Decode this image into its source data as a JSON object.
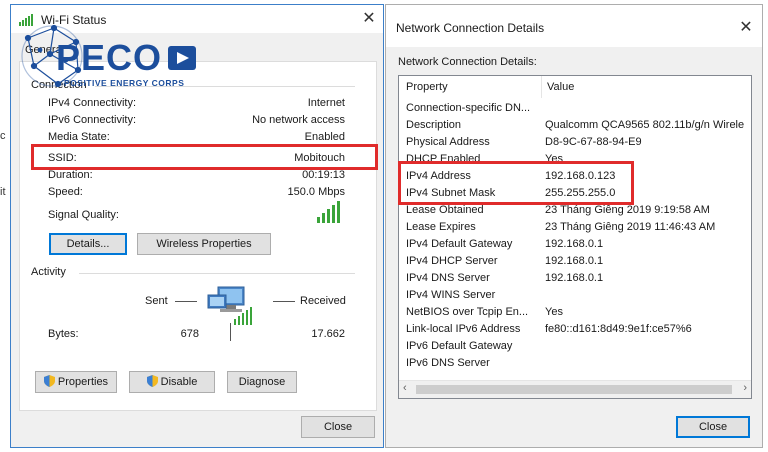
{
  "wifi": {
    "title": "Wi-Fi Status",
    "tab_general": "General",
    "connection_heading": "Connection",
    "rows": [
      {
        "label": "IPv4 Connectivity:",
        "value": "Internet"
      },
      {
        "label": "IPv6 Connectivity:",
        "value": "No network access"
      },
      {
        "label": "Media State:",
        "value": "Enabled"
      },
      {
        "label": "SSID:",
        "value": "Mobitouch"
      },
      {
        "label": "Duration:",
        "value": "00:19:13"
      },
      {
        "label": "Speed:",
        "value": "150.0 Mbps"
      }
    ],
    "signal_label": "Signal Quality:",
    "signal_level": 5,
    "details_button": "Details...",
    "wireless_props_button": "Wireless Properties",
    "activity_heading": "Activity",
    "sent_label": "Sent",
    "received_label": "Received",
    "bytes_label": "Bytes:",
    "bytes_sent": "678",
    "bytes_received": "17.662",
    "properties_button": "Properties",
    "disable_button": "Disable",
    "diagnose_button": "Diagnose",
    "close_button": "Close"
  },
  "logo": {
    "name": "PECO",
    "tagline": "POSITIVE ENERGY CORPS",
    "color": "#1c4e9c"
  },
  "details": {
    "title": "Network Connection Details",
    "caption": "Network Connection Details:",
    "col_property": "Property",
    "col_value": "Value",
    "rows": [
      {
        "property": "Connection-specific DN...",
        "value": ""
      },
      {
        "property": "Description",
        "value": "Qualcomm QCA9565 802.11b/g/n Wirele"
      },
      {
        "property": "Physical Address",
        "value": "D8-9C-67-88-94-E9"
      },
      {
        "property": "DHCP Enabled",
        "value": "Yes"
      },
      {
        "property": "IPv4 Address",
        "value": "192.168.0.123"
      },
      {
        "property": "IPv4 Subnet Mask",
        "value": "255.255.255.0"
      },
      {
        "property": "Lease Obtained",
        "value": "23 Tháng Giêng 2019 9:19:58 AM"
      },
      {
        "property": "Lease Expires",
        "value": "23 Tháng Giêng 2019 11:46:43 AM"
      },
      {
        "property": "IPv4 Default Gateway",
        "value": "192.168.0.1"
      },
      {
        "property": "IPv4 DHCP Server",
        "value": "192.168.0.1"
      },
      {
        "property": "IPv4 DNS Server",
        "value": "192.168.0.1"
      },
      {
        "property": "IPv4 WINS Server",
        "value": ""
      },
      {
        "property": "NetBIOS over Tcpip En...",
        "value": "Yes"
      },
      {
        "property": "Link-local IPv6 Address",
        "value": "fe80::d161:8d49:9e1f:ce57%6"
      },
      {
        "property": "IPv6 Default Gateway",
        "value": ""
      },
      {
        "property": "IPv6 DNS Server",
        "value": ""
      }
    ],
    "close_button": "Close"
  },
  "colors": {
    "highlight": "#e02b2b",
    "signal": "#3aa43a",
    "focus": "#0078d7"
  }
}
